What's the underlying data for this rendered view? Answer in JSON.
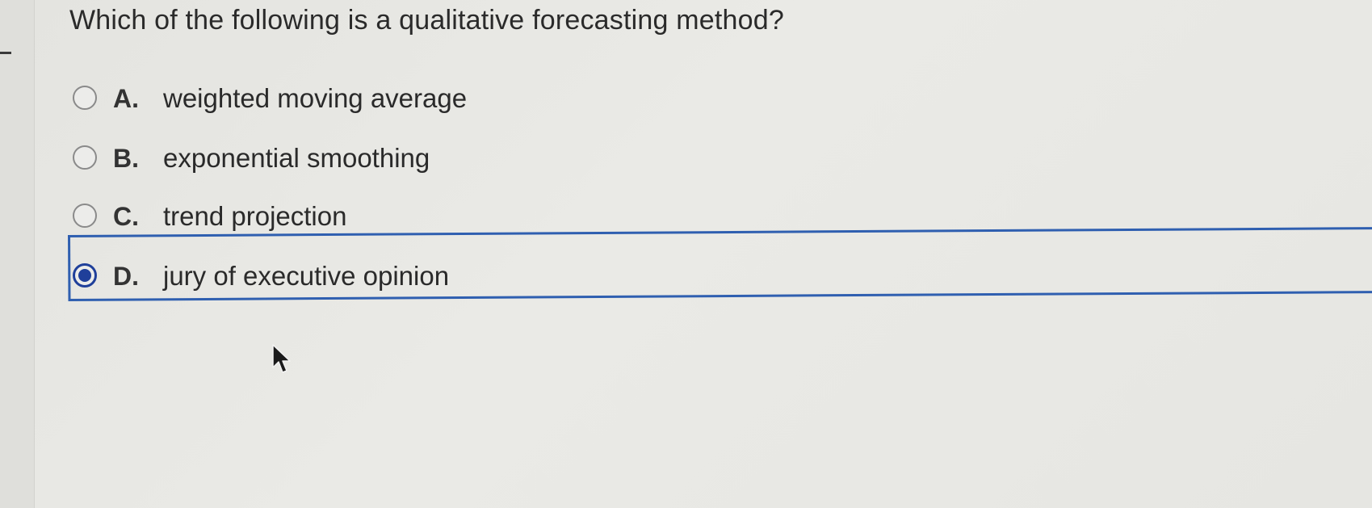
{
  "question": {
    "text": "Which of the following is a qualitative forecasting method?"
  },
  "options": [
    {
      "letter": "A.",
      "label": "weighted moving average",
      "selected": false
    },
    {
      "letter": "B.",
      "label": "exponential smoothing",
      "selected": false
    },
    {
      "letter": "C.",
      "label": "trend projection",
      "selected": false
    },
    {
      "letter": "D.",
      "label": "jury of executive opinion",
      "selected": true
    }
  ],
  "colors": {
    "selected_accent": "#2f5fb0",
    "radio_fill_selected": "#1f3f9a",
    "radio_border_unselected": "#8a8a8a"
  },
  "icons": {
    "cursor": "mouse-pointer-icon"
  }
}
